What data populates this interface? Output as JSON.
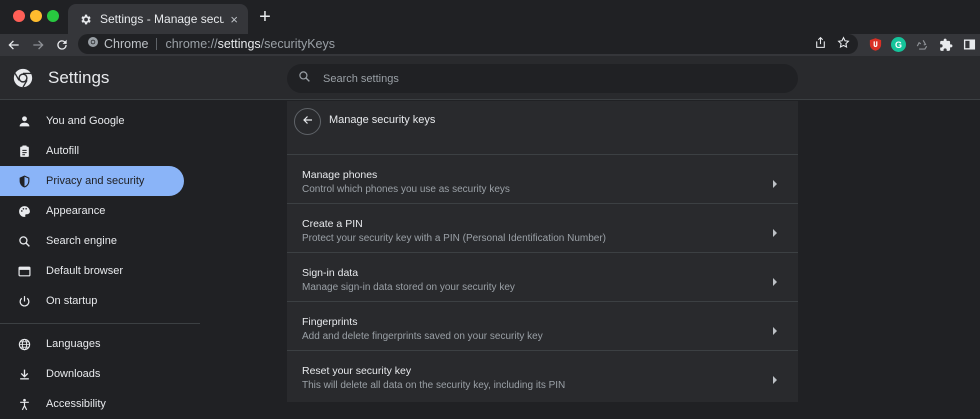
{
  "browser": {
    "tab_title": "Settings - Manage security keys",
    "tab_close": "×",
    "newtab": "+",
    "omnibox_site": "Chrome",
    "url_prefix": "chrome://",
    "url_host": "settings",
    "url_path": "/securityKeys",
    "extensions": [
      {
        "name": "ublock-icon",
        "label": "",
        "color": "#d93025"
      },
      {
        "name": "grammarly-icon",
        "label": "G",
        "color": "#15c39a"
      }
    ]
  },
  "header": {
    "title": "Settings",
    "search_placeholder": "Search settings"
  },
  "sidebar": {
    "items": [
      {
        "label": "You and Google",
        "icon": "person-icon",
        "active": false
      },
      {
        "label": "Autofill",
        "icon": "clipboard-icon",
        "active": false
      },
      {
        "label": "Privacy and security",
        "icon": "shield-icon",
        "active": true
      },
      {
        "label": "Appearance",
        "icon": "palette-icon",
        "active": false
      },
      {
        "label": "Search engine",
        "icon": "search-icon",
        "active": false
      },
      {
        "label": "Default browser",
        "icon": "browser-icon",
        "active": false
      },
      {
        "label": "On startup",
        "icon": "power-icon",
        "active": false
      },
      {
        "label": "Languages",
        "icon": "globe-icon",
        "active": false
      },
      {
        "label": "Downloads",
        "icon": "download-icon",
        "active": false
      },
      {
        "label": "Accessibility",
        "icon": "accessibility-icon",
        "active": false
      }
    ]
  },
  "main": {
    "title": "Manage security keys",
    "rows": [
      {
        "title": "Manage phones",
        "subtitle": "Control which phones you use as security keys"
      },
      {
        "title": "Create a PIN",
        "subtitle": "Protect your security key with a PIN (Personal Identification Number)"
      },
      {
        "title": "Sign-in data",
        "subtitle": "Manage sign-in data stored on your security key"
      },
      {
        "title": "Fingerprints",
        "subtitle": "Add and delete fingerprints saved on your security key"
      },
      {
        "title": "Reset your security key",
        "subtitle": "This will delete all data on the security key, including its PIN"
      }
    ]
  },
  "colors": {
    "accent": "#8ab4f8",
    "background": "#202124",
    "surface": "#292a2d"
  }
}
